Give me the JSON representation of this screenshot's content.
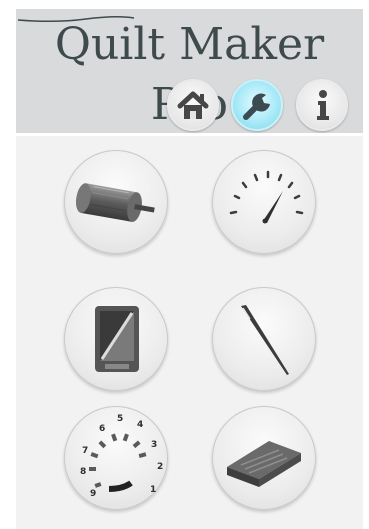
{
  "app": {
    "title": "Quilt Maker Pro"
  },
  "header": {
    "buttons": [
      {
        "icon": "home-icon",
        "active": false
      },
      {
        "icon": "wrench-icon",
        "active": true
      },
      {
        "icon": "info-icon",
        "active": false
      }
    ]
  },
  "tools": [
    {
      "icon": "bobbin-icon"
    },
    {
      "icon": "speed-gauge-icon"
    },
    {
      "icon": "tablet-icon"
    },
    {
      "icon": "needle-icon"
    },
    {
      "icon": "tension-dial-icon",
      "dial_numbers": [
        "1",
        "2",
        "3",
        "4",
        "5",
        "6",
        "7",
        "8",
        "9"
      ]
    },
    {
      "icon": "foot-pedal-icon"
    }
  ],
  "colors": {
    "header_bg": "#d9dadc",
    "panel_bg": "#f2f2f3",
    "logo_text": "#3f4a4d",
    "active_accent": "#7fd4e8"
  }
}
